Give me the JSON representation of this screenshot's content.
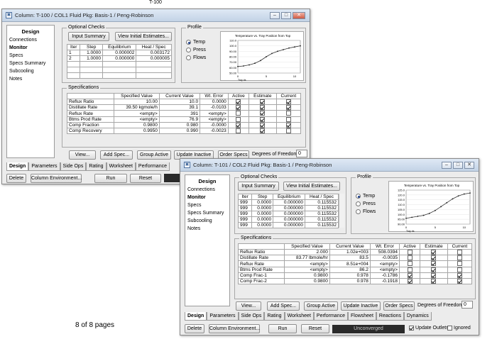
{
  "page": {
    "top_caption": "T-100",
    "pages_label": "8 of 8 pages"
  },
  "win1": {
    "title": "Column: T-100 / COL1 Fluid Pkg: Basis-1 / Peng-Robinson",
    "sidebar": {
      "header": "Design",
      "items": [
        "Connections",
        "Monitor",
        "Specs",
        "Specs Summary",
        "Subcooling",
        "Notes"
      ],
      "selected": 1
    },
    "optional_checks": {
      "label": "Optional Checks",
      "input_summary": "Input Summary",
      "view_initial": "View Initial Estimates...",
      "columns": [
        "Iter",
        "Step",
        "Equilibrium",
        "Heat / Spec"
      ],
      "rows": [
        [
          "1",
          "1.0000",
          "0.000002",
          "0.003172"
        ],
        [
          "2",
          "1.0000",
          "0.000000",
          "0.000005"
        ]
      ]
    },
    "profile": {
      "label": "Profile",
      "options": [
        "Temp",
        "Press",
        "Flows"
      ],
      "selected": 0,
      "chart_data": {
        "type": "line",
        "title": "Temperature vs. Tray Position from Top",
        "xlabel": "Tray #s",
        "ylabel": "",
        "x_ticks": [
          "0",
          "5",
          "10"
        ],
        "y_ticks": [
          "50.00",
          "60.00",
          "70.00",
          "80.00",
          "90.00",
          "100.0",
          "110.0"
        ],
        "ylim": [
          50,
          110
        ],
        "x": [
          0,
          1,
          2,
          3,
          4,
          5,
          6,
          7,
          8,
          9,
          10,
          11
        ],
        "series": [
          {
            "values": [
              62,
              63,
              65,
              68,
              73,
              80,
              86,
              90,
              93,
              96,
              98,
              100
            ]
          }
        ]
      }
    },
    "specs": {
      "label": "Specifications",
      "columns": [
        "",
        "Specified Value",
        "Current Value",
        "Wt. Error",
        "Active",
        "Estimate",
        "Current"
      ],
      "rows": [
        {
          "name": "Reflux Ratio",
          "spec": "10.00",
          "cur": "10.0",
          "err": "0.0000",
          "a": true,
          "e": true,
          "c": true
        },
        {
          "name": "Distillate Rate",
          "spec": "39.50 kgmole/h",
          "cur": "39.1",
          "err": "-0.0103",
          "a": true,
          "e": true,
          "c": true
        },
        {
          "name": "Reflux Rate",
          "spec": "<empty>",
          "cur": "391",
          "err": "<empty>",
          "a": false,
          "e": true,
          "c": false
        },
        {
          "name": "Btms Prod Rate",
          "spec": "<empty>",
          "cur": "76.9",
          "err": "<empty>",
          "a": false,
          "e": true,
          "c": false
        },
        {
          "name": "Comp Fraction",
          "spec": "0.9800",
          "cur": "0.980",
          "err": "-0.0000",
          "a": true,
          "e": true,
          "c": true
        },
        {
          "name": "Comp Recovery",
          "spec": "0.9950",
          "cur": "0.990",
          "err": "-0.0023",
          "a": false,
          "e": true,
          "c": false
        }
      ]
    },
    "buttons": {
      "view": "View...",
      "add_spec": "Add Spec...",
      "group_active": "Group Active",
      "update_inactive": "Update Inactive",
      "order_specs": "Order Specs"
    },
    "dof_label": "Degrees of Freedom",
    "dof_value": "0",
    "tabs": [
      "Design",
      "Parameters",
      "Side Ops",
      "Rating",
      "Worksheet",
      "Performance"
    ],
    "tab_selected": 0,
    "bottom": {
      "delete": "Delete",
      "col_env": "Column Environment...",
      "run": "Run",
      "reset": "Reset"
    }
  },
  "win2": {
    "title": "Column: T-101 / COL2 Fluid Pkg: Basis-1 / Peng-Robinson",
    "sidebar": {
      "header": "Design",
      "items": [
        "Connections",
        "Monitor",
        "Specs",
        "Specs Summary",
        "Subcooling",
        "Notes"
      ],
      "selected": 1
    },
    "optional_checks": {
      "label": "Optional Checks",
      "input_summary": "Input Summary",
      "view_initial": "View Initial Estimates...",
      "columns": [
        "Iter",
        "Step",
        "Equilibrium",
        "Heat / Spec"
      ],
      "rows": [
        [
          "999",
          "0.0000",
          "0.000000",
          "0.115532"
        ],
        [
          "999",
          "0.0000",
          "0.000000",
          "0.115532"
        ],
        [
          "999",
          "0.0000",
          "0.000000",
          "0.115532"
        ],
        [
          "999",
          "0.0000",
          "0.000000",
          "0.115532"
        ],
        [
          "999",
          "0.0000",
          "0.000000",
          "0.115532"
        ]
      ]
    },
    "profile": {
      "label": "Profile",
      "options": [
        "Temp",
        "Press",
        "Flows"
      ],
      "selected": 0,
      "chart_data": {
        "type": "line",
        "title": "Temperature vs. Tray Position from Top",
        "xlabel": "Tray #s",
        "ylabel": "",
        "x_ticks": [
          "0",
          "5",
          "10"
        ],
        "y_ticks": [
          "90.00",
          "95.00",
          "100.0",
          "105.0",
          "110.0",
          "115.0",
          "120.0",
          "125.0"
        ],
        "ylim": [
          90,
          125
        ],
        "x": [
          0,
          1,
          2,
          3,
          4,
          5,
          6,
          7,
          8,
          9,
          10,
          11
        ],
        "series": [
          {
            "values": [
              96,
              97,
              98,
              99,
              101,
              104,
              108,
              112,
              116,
              119,
              121,
              122
            ]
          }
        ]
      }
    },
    "specs": {
      "label": "Specifications",
      "columns": [
        "",
        "Specified Value",
        "Current Value",
        "Wt. Error",
        "Active",
        "Estimate",
        "Current"
      ],
      "rows": [
        {
          "name": "Reflux Ratio",
          "spec": "2.000",
          "cur": "1.02e+003",
          "err": "508.0394",
          "a": false,
          "e": true,
          "c": false
        },
        {
          "name": "Distillate Rate",
          "spec": "83.77 lbmole/hr",
          "cur": "83.5",
          "err": "-0.0035",
          "a": false,
          "e": true,
          "c": false
        },
        {
          "name": "Reflux Rate",
          "spec": "<empty>",
          "cur": "8.51e+004",
          "err": "<empty>",
          "a": false,
          "e": true,
          "c": false
        },
        {
          "name": "Btms Prod Rate",
          "spec": "<empty>",
          "cur": "86.2",
          "err": "<empty>",
          "a": false,
          "e": true,
          "c": false
        },
        {
          "name": "Comp Frac-1",
          "spec": "0.9800",
          "cur": "0.978",
          "err": "-0.1786",
          "a": true,
          "e": true,
          "c": true
        },
        {
          "name": "Comp Frac-2",
          "spec": "0.9800",
          "cur": "0.978",
          "err": "-0.1918",
          "a": true,
          "e": true,
          "c": true
        }
      ]
    },
    "buttons": {
      "view": "View...",
      "add_spec": "Add Spec...",
      "group_active": "Group Active",
      "update_inactive": "Update Inactive",
      "order_specs": "Order Specs"
    },
    "dof_label": "Degrees of Freedom",
    "dof_value": "0",
    "tabs": [
      "Design",
      "Parameters",
      "Side Ops",
      "Rating",
      "Worksheet",
      "Performance",
      "Flowsheet",
      "Reactions",
      "Dynamics"
    ],
    "tab_selected": 0,
    "bottom": {
      "delete": "Delete",
      "col_env": "Column Environment...",
      "run": "Run",
      "reset": "Reset",
      "status": "Unconverged",
      "update_outlets": "Update Outlets",
      "ignored": "Ignored"
    },
    "update_outlets_checked": true,
    "ignored_checked": false
  }
}
